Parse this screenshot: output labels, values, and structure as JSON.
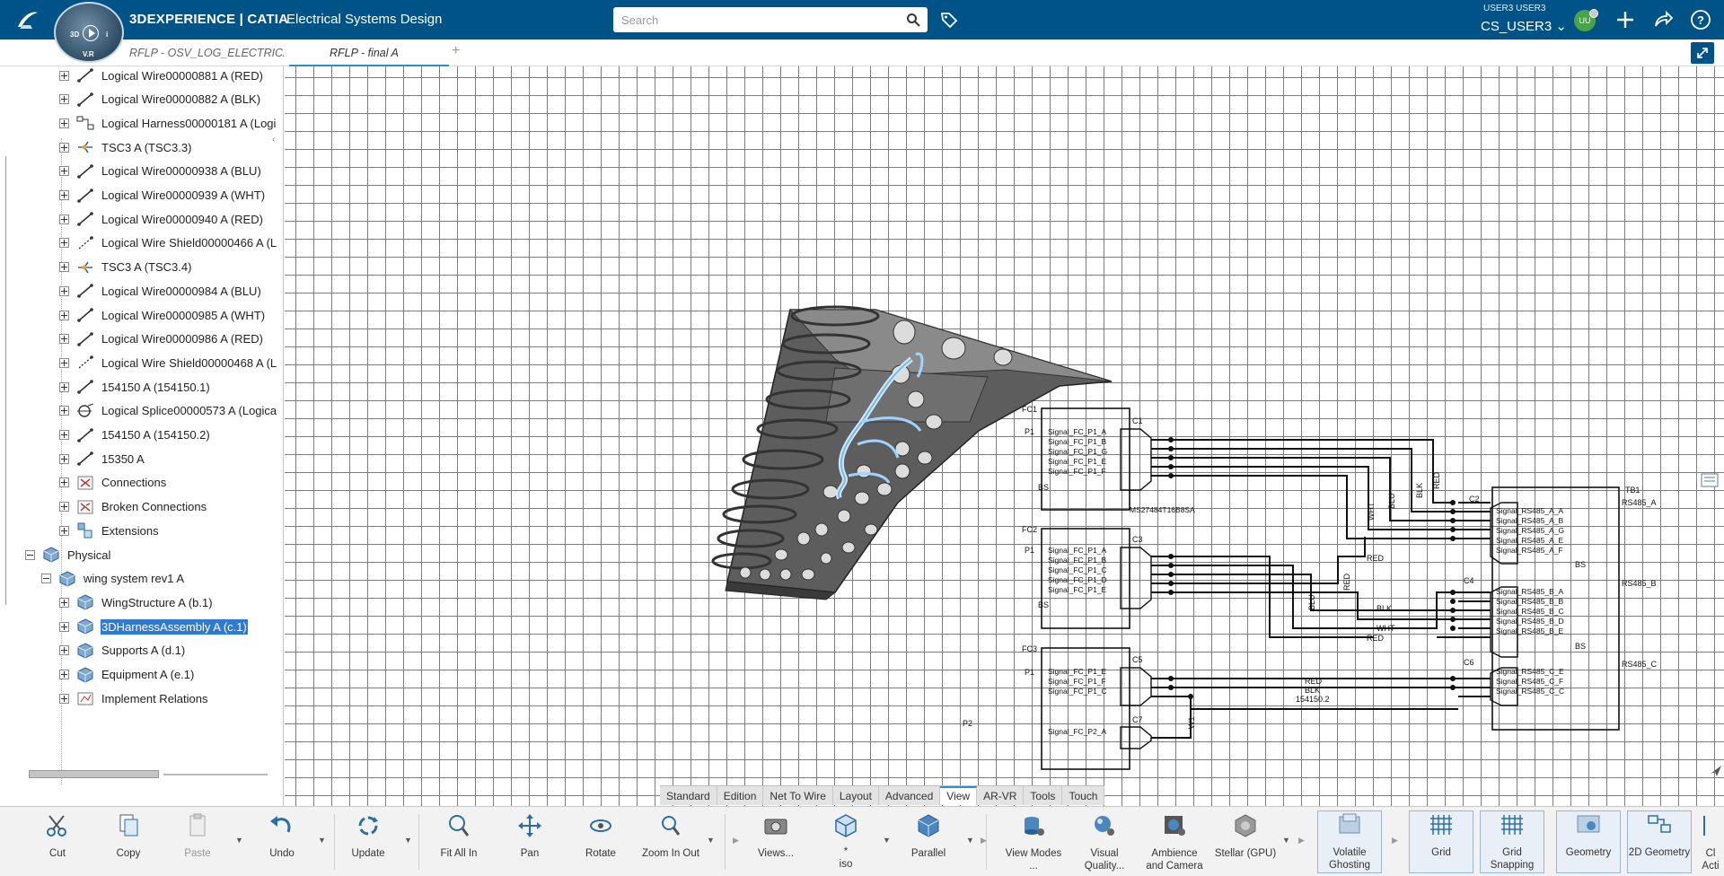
{
  "app": {
    "brand": "3DEXPERIENCE | CATIA",
    "subtitle": "Electrical Systems Design",
    "compass_labels": [
      "3D",
      "V.R",
      "i"
    ]
  },
  "search": {
    "placeholder": "Search"
  },
  "user": {
    "small_label": "USER3 USER3",
    "name": "CS_USER3",
    "initials": "UU"
  },
  "tabs": [
    {
      "label": "RFLP - OSV_LOG_ELECTRICA"
    },
    {
      "label": "RFLP - final A"
    }
  ],
  "tree": {
    "items": [
      {
        "label": "Logical Wire00000881 A (RED)",
        "icon": "wire-icon"
      },
      {
        "label": "Logical Wire00000882 A (BLK)",
        "icon": "wire-icon"
      },
      {
        "label": "Logical Harness00000181 A (Logi",
        "icon": "harness-icon"
      },
      {
        "label": "TSC3 A (TSC3.3)",
        "icon": "connector-icon"
      },
      {
        "label": "Logical Wire00000938 A (BLU)",
        "icon": "wire-icon"
      },
      {
        "label": "Logical Wire00000939 A (WHT)",
        "icon": "wire-icon"
      },
      {
        "label": "Logical Wire00000940 A (RED)",
        "icon": "wire-icon"
      },
      {
        "label": "Logical Wire Shield00000466 A (L",
        "icon": "shield-icon"
      },
      {
        "label": "TSC3 A (TSC3.4)",
        "icon": "connector-icon"
      },
      {
        "label": "Logical Wire00000984 A (BLU)",
        "icon": "wire-icon"
      },
      {
        "label": "Logical Wire00000985 A (WHT)",
        "icon": "wire-icon"
      },
      {
        "label": "Logical Wire00000986 A (RED)",
        "icon": "wire-icon"
      },
      {
        "label": "Logical Wire Shield00000468 A (L",
        "icon": "shield-icon"
      },
      {
        "label": "154150 A (154150.1)",
        "icon": "wire-icon"
      },
      {
        "label": "Logical Splice00000573 A (Logica",
        "icon": "splice-icon"
      },
      {
        "label": "154150 A (154150.2)",
        "icon": "wire-icon"
      },
      {
        "label": "15350 A",
        "icon": "wire-icon"
      },
      {
        "label": "Connections",
        "icon": "connections-icon"
      },
      {
        "label": "Broken Connections",
        "icon": "broken-connections-icon"
      },
      {
        "label": "Extensions",
        "icon": "extensions-icon"
      },
      {
        "label": "Physical",
        "icon": "product-icon"
      },
      {
        "label": "wing system rev1 A",
        "icon": "product-icon"
      },
      {
        "label": "WingStructure A (b.1)",
        "icon": "product-icon"
      },
      {
        "label": "3DHarnessAssembly A (c.1)",
        "icon": "product-icon",
        "selected": true
      },
      {
        "label": "Supports A (d.1)",
        "icon": "product-icon"
      },
      {
        "label": "Equipment A (e.1)",
        "icon": "product-icon"
      },
      {
        "label": "Implement Relations",
        "icon": "relations-icon"
      }
    ]
  },
  "schematic": {
    "fc_labels": [
      "FC1",
      "FC2",
      "FC3"
    ],
    "p_labels": [
      "P1",
      "P1",
      "P1",
      "P2"
    ],
    "bs_labels": [
      "BS",
      "BS",
      "BS",
      "BS"
    ],
    "connectors": [
      "C1",
      "C2",
      "C3",
      "C4",
      "C5",
      "C6",
      "C7"
    ],
    "fc1_signals": [
      "Signal_FC_P1_A",
      "Signal_FC_P1_B",
      "Signal_FC_P1_G",
      "Signal_FC_P1_E",
      "Signal_FC_P1_F"
    ],
    "fc2_signals": [
      "Signal_FC_P1_A",
      "Signal_FC_P1_B",
      "Signal_FC_P1_C",
      "Signal_FC_P1_D",
      "Signal_FC_P1_E"
    ],
    "fc3_signals": [
      "Signal_FC_P1_E",
      "Signal_FC_P1_F",
      "Signal_FC_P1_C"
    ],
    "fc3_p2_signal": "Signal_FC_P2_A",
    "part_number": "MS27484T16B8SA",
    "tb_label": "TB1",
    "rs_a_signals": [
      "Signal_RS485_A_A",
      "Signal_RS485_A_B",
      "Signal_RS485_A_G",
      "Signal_RS485_A_E",
      "Signal_RS485_A_F"
    ],
    "rs_b_signals": [
      "Signal_RS485_B_A",
      "Signal_RS485_B_B",
      "Signal_RS485_B_C",
      "Signal_RS485_B_D",
      "Signal_RS485_B_E"
    ],
    "rs_c_signals": [
      "Signal_RS485_C_E",
      "Signal_RS485_C_F",
      "Signal_RS485_C_C"
    ],
    "rs_port_labels": [
      "RS485_A",
      "RS485_B",
      "RS485_C"
    ],
    "wire_labels_upper": [
      "WHT",
      "BLU",
      "BLK",
      "RED",
      "RED"
    ],
    "wire_labels_middle": [
      "RED",
      "BLU",
      "BLK",
      "WHT",
      "RED"
    ],
    "wire_labels_lower": [
      "RED",
      "BLK",
      "154150.2",
      "W1"
    ]
  },
  "view_tabs": [
    "Standard",
    "Edition",
    "Net To Wire",
    "Layout",
    "Advanced",
    "View",
    "AR-VR",
    "Tools",
    "Touch"
  ],
  "active_view_tab": "View",
  "toolbar": {
    "cut": "Cut",
    "copy": "Copy",
    "paste": "Paste",
    "undo": "Undo",
    "update": "Update",
    "fit_all_in": "Fit All In",
    "pan": "Pan",
    "rotate": "Rotate",
    "zoom_in_out": "Zoom In Out",
    "views": "Views...",
    "iso_star": "*",
    "iso": "iso",
    "parallel": "Parallel",
    "view_modes": "View Modes ...",
    "visual_quality": "Visual Quality...",
    "ambience": "Ambience and Camera",
    "stellar": "Stellar (GPU)",
    "volatile_ghosting": "Volatile Ghosting",
    "grid": "Grid",
    "grid_snapping": "Grid Snapping",
    "geometry": "Geometry",
    "geometry_2d": "2D Geometry",
    "clip": "Cl Acti"
  }
}
